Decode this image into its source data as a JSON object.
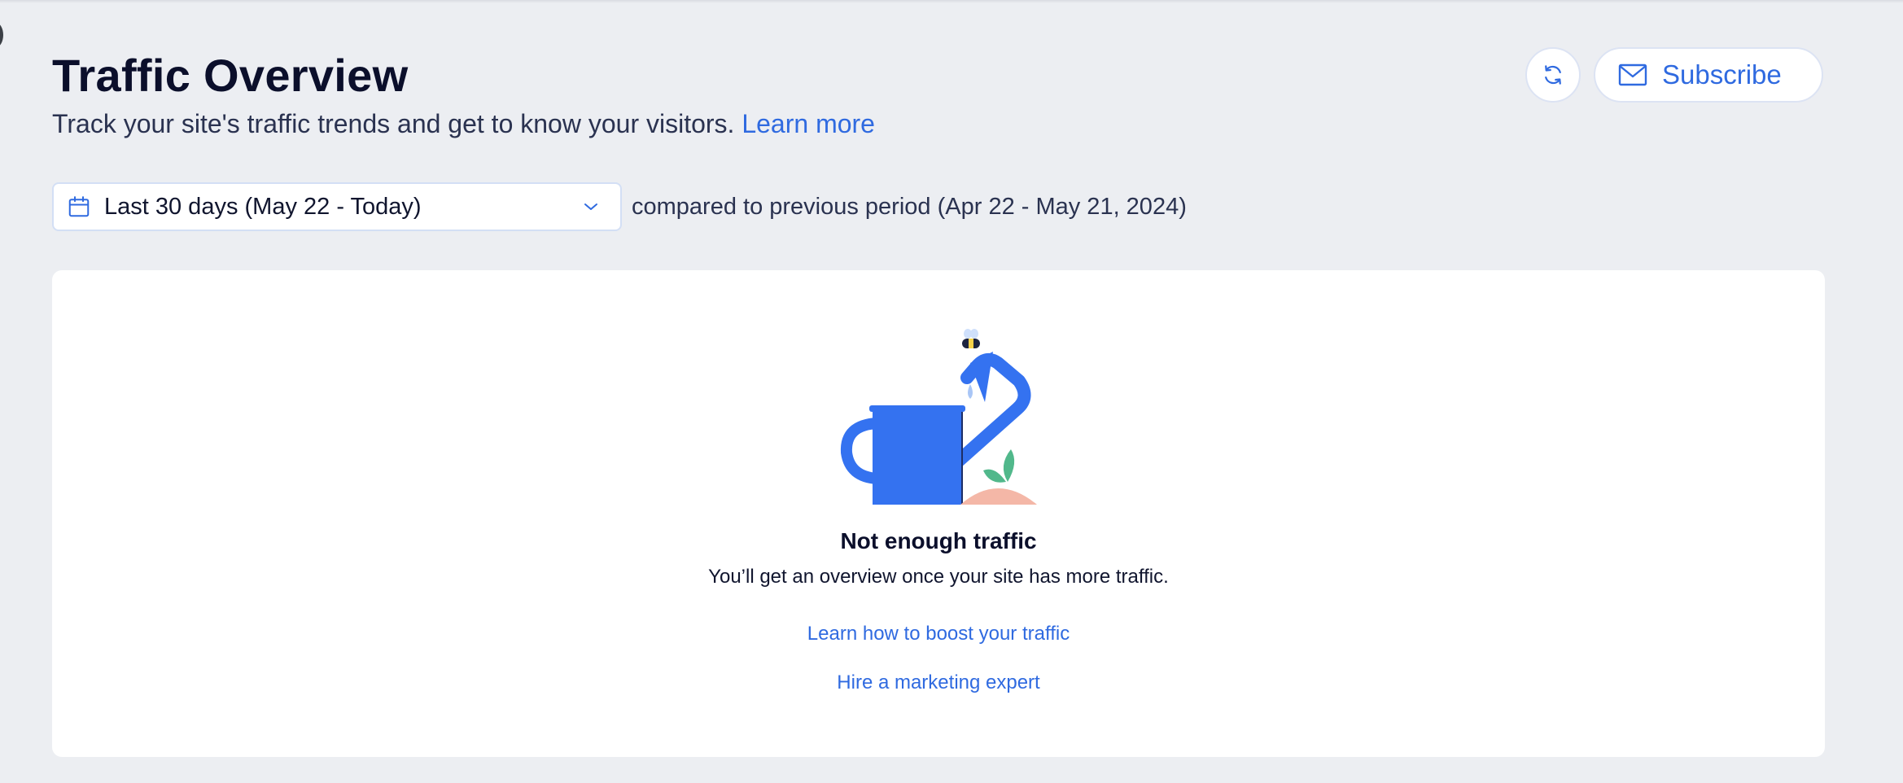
{
  "header": {
    "title": "Traffic Overview",
    "subtitle": "Track your site's traffic trends and get to know your visitors.",
    "learn_more": "Learn more"
  },
  "toolbar": {
    "refresh_icon": "refresh-icon",
    "subscribe_icon": "envelope-icon",
    "subscribe_label": "Subscribe"
  },
  "filters": {
    "date_range_icon": "calendar-icon",
    "date_range": "Last 30 days (May 22 - Today)",
    "dropdown_icon": "chevron-down-icon",
    "comparison": "compared to previous period (Apr 22 - May 21, 2024)"
  },
  "empty_state": {
    "illustration": "watering-can-illustration",
    "title": "Not enough traffic",
    "description": "You’ll get an overview once your site has more traffic.",
    "links": [
      "Learn how to boost your traffic",
      "Hire a marketing expert"
    ]
  },
  "colors": {
    "accent": "#2f6ae0",
    "background": "#eceef2",
    "card": "#ffffff",
    "illustration_blue": "#3472f0"
  }
}
